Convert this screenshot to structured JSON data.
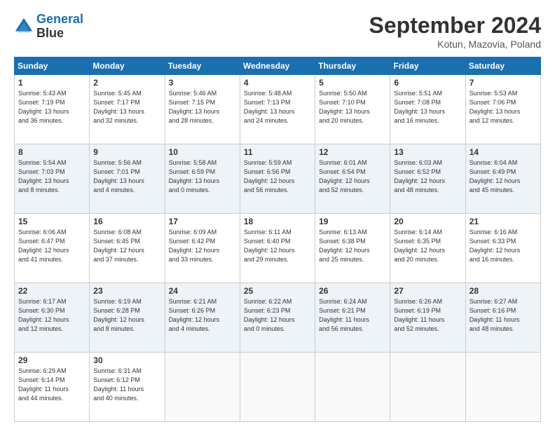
{
  "header": {
    "logo_line1": "General",
    "logo_line2": "Blue",
    "month": "September 2024",
    "location": "Kotun, Mazovia, Poland"
  },
  "days_of_week": [
    "Sunday",
    "Monday",
    "Tuesday",
    "Wednesday",
    "Thursday",
    "Friday",
    "Saturday"
  ],
  "weeks": [
    [
      {
        "num": "1",
        "info": "Sunrise: 5:43 AM\nSunset: 7:19 PM\nDaylight: 13 hours\nand 36 minutes."
      },
      {
        "num": "2",
        "info": "Sunrise: 5:45 AM\nSunset: 7:17 PM\nDaylight: 13 hours\nand 32 minutes."
      },
      {
        "num": "3",
        "info": "Sunrise: 5:46 AM\nSunset: 7:15 PM\nDaylight: 13 hours\nand 28 minutes."
      },
      {
        "num": "4",
        "info": "Sunrise: 5:48 AM\nSunset: 7:13 PM\nDaylight: 13 hours\nand 24 minutes."
      },
      {
        "num": "5",
        "info": "Sunrise: 5:50 AM\nSunset: 7:10 PM\nDaylight: 13 hours\nand 20 minutes."
      },
      {
        "num": "6",
        "info": "Sunrise: 5:51 AM\nSunset: 7:08 PM\nDaylight: 13 hours\nand 16 minutes."
      },
      {
        "num": "7",
        "info": "Sunrise: 5:53 AM\nSunset: 7:06 PM\nDaylight: 13 hours\nand 12 minutes."
      }
    ],
    [
      {
        "num": "8",
        "info": "Sunrise: 5:54 AM\nSunset: 7:03 PM\nDaylight: 13 hours\nand 8 minutes."
      },
      {
        "num": "9",
        "info": "Sunrise: 5:56 AM\nSunset: 7:01 PM\nDaylight: 13 hours\nand 4 minutes."
      },
      {
        "num": "10",
        "info": "Sunrise: 5:58 AM\nSunset: 6:59 PM\nDaylight: 13 hours\nand 0 minutes."
      },
      {
        "num": "11",
        "info": "Sunrise: 5:59 AM\nSunset: 6:56 PM\nDaylight: 12 hours\nand 56 minutes."
      },
      {
        "num": "12",
        "info": "Sunrise: 6:01 AM\nSunset: 6:54 PM\nDaylight: 12 hours\nand 52 minutes."
      },
      {
        "num": "13",
        "info": "Sunrise: 6:03 AM\nSunset: 6:52 PM\nDaylight: 12 hours\nand 48 minutes."
      },
      {
        "num": "14",
        "info": "Sunrise: 6:04 AM\nSunset: 6:49 PM\nDaylight: 12 hours\nand 45 minutes."
      }
    ],
    [
      {
        "num": "15",
        "info": "Sunrise: 6:06 AM\nSunset: 6:47 PM\nDaylight: 12 hours\nand 41 minutes."
      },
      {
        "num": "16",
        "info": "Sunrise: 6:08 AM\nSunset: 6:45 PM\nDaylight: 12 hours\nand 37 minutes."
      },
      {
        "num": "17",
        "info": "Sunrise: 6:09 AM\nSunset: 6:42 PM\nDaylight: 12 hours\nand 33 minutes."
      },
      {
        "num": "18",
        "info": "Sunrise: 6:11 AM\nSunset: 6:40 PM\nDaylight: 12 hours\nand 29 minutes."
      },
      {
        "num": "19",
        "info": "Sunrise: 6:13 AM\nSunset: 6:38 PM\nDaylight: 12 hours\nand 25 minutes."
      },
      {
        "num": "20",
        "info": "Sunrise: 6:14 AM\nSunset: 6:35 PM\nDaylight: 12 hours\nand 20 minutes."
      },
      {
        "num": "21",
        "info": "Sunrise: 6:16 AM\nSunset: 6:33 PM\nDaylight: 12 hours\nand 16 minutes."
      }
    ],
    [
      {
        "num": "22",
        "info": "Sunrise: 6:17 AM\nSunset: 6:30 PM\nDaylight: 12 hours\nand 12 minutes."
      },
      {
        "num": "23",
        "info": "Sunrise: 6:19 AM\nSunset: 6:28 PM\nDaylight: 12 hours\nand 8 minutes."
      },
      {
        "num": "24",
        "info": "Sunrise: 6:21 AM\nSunset: 6:26 PM\nDaylight: 12 hours\nand 4 minutes."
      },
      {
        "num": "25",
        "info": "Sunrise: 6:22 AM\nSunset: 6:23 PM\nDaylight: 12 hours\nand 0 minutes."
      },
      {
        "num": "26",
        "info": "Sunrise: 6:24 AM\nSunset: 6:21 PM\nDaylight: 11 hours\nand 56 minutes."
      },
      {
        "num": "27",
        "info": "Sunrise: 6:26 AM\nSunset: 6:19 PM\nDaylight: 11 hours\nand 52 minutes."
      },
      {
        "num": "28",
        "info": "Sunrise: 6:27 AM\nSunset: 6:16 PM\nDaylight: 11 hours\nand 48 minutes."
      }
    ],
    [
      {
        "num": "29",
        "info": "Sunrise: 6:29 AM\nSunset: 6:14 PM\nDaylight: 11 hours\nand 44 minutes."
      },
      {
        "num": "30",
        "info": "Sunrise: 6:31 AM\nSunset: 6:12 PM\nDaylight: 11 hours\nand 40 minutes."
      },
      {
        "num": "",
        "info": ""
      },
      {
        "num": "",
        "info": ""
      },
      {
        "num": "",
        "info": ""
      },
      {
        "num": "",
        "info": ""
      },
      {
        "num": "",
        "info": ""
      }
    ]
  ]
}
